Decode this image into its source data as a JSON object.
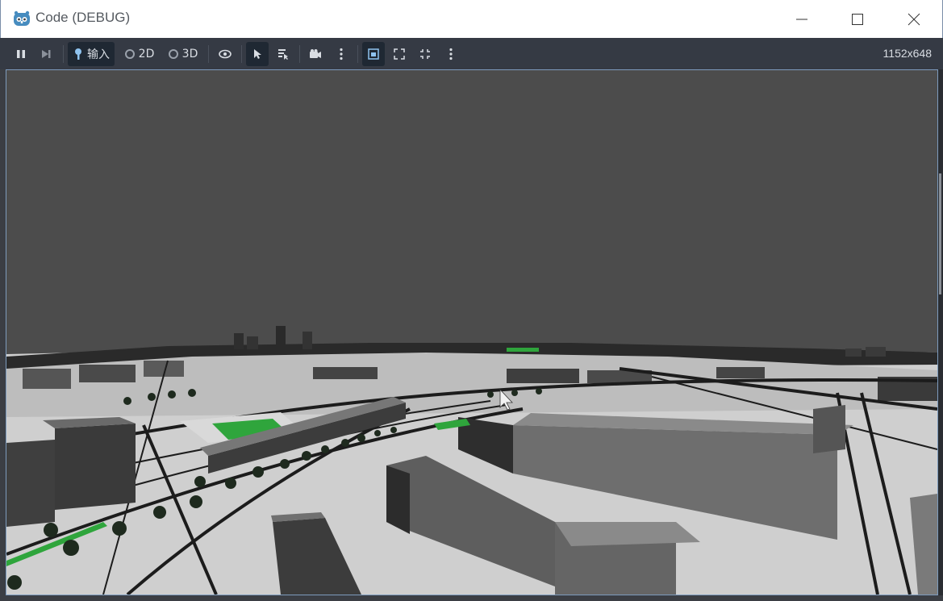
{
  "window": {
    "title": "Code (DEBUG)",
    "minimize_icon": "minimize-icon",
    "maximize_icon": "maximize-icon",
    "close_icon": "close-icon"
  },
  "toolbar": {
    "pause_icon": "pause-icon",
    "next_frame_icon": "next-frame-icon",
    "input_label": "输入",
    "mode_2d_label": "2D",
    "mode_3d_label": "3D",
    "visibility_icon": "eye-icon",
    "select_icon": "arrow-cursor-icon",
    "list_select_icon": "list-select-icon",
    "camera_icon": "camera-icon",
    "more_icon": "vertical-ellipsis-icon",
    "embed_icon": "embed-window-icon",
    "fit_icon": "fit-icon",
    "fullscreen_icon": "fullscreen-icon",
    "resolution": "1152x648"
  },
  "viewport": {
    "sky_color": "#4c4c4c",
    "ground_color": "#d2d2d2",
    "building_color": "#6e6e6e",
    "tree_color": "#2e3a2a",
    "park_color": "#2fa53c"
  }
}
